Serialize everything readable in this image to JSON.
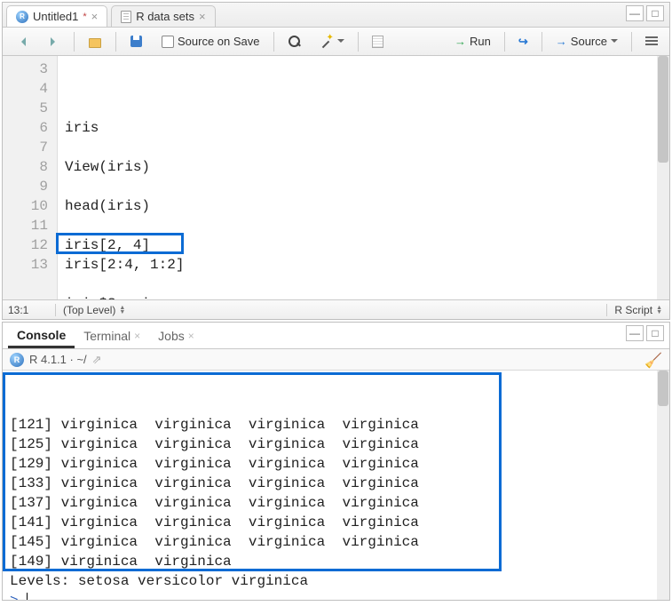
{
  "editor": {
    "tabs": [
      {
        "label": "Untitled1",
        "dirty": "*",
        "icon": "r"
      },
      {
        "label": "R data sets",
        "dirty": "",
        "icon": "doc"
      }
    ],
    "toolbar": {
      "source_on_save": "Source on Save",
      "run": "Run",
      "source": "Source"
    },
    "lines": [
      {
        "n": "3",
        "text": "iris"
      },
      {
        "n": "4",
        "text": ""
      },
      {
        "n": "5",
        "text": "View(iris)"
      },
      {
        "n": "6",
        "text": ""
      },
      {
        "n": "7",
        "text": "head(iris)"
      },
      {
        "n": "8",
        "text": ""
      },
      {
        "n": "9",
        "text": "iris[2, 4]"
      },
      {
        "n": "10",
        "text": "iris[2:4, 1:2]"
      },
      {
        "n": "11",
        "text": ""
      },
      {
        "n": "12",
        "text": "iris$Species"
      },
      {
        "n": "13",
        "text": ""
      }
    ],
    "status": {
      "position": "13:1",
      "scope": "(Top Level)",
      "language": "R Script"
    }
  },
  "console": {
    "tabs": {
      "console": "Console",
      "terminal": "Terminal",
      "jobs": "Jobs"
    },
    "info": "R 4.1.1 · ~/",
    "output_lines": [
      "[121] virginica  virginica  virginica  virginica ",
      "[125] virginica  virginica  virginica  virginica ",
      "[129] virginica  virginica  virginica  virginica ",
      "[133] virginica  virginica  virginica  virginica ",
      "[137] virginica  virginica  virginica  virginica ",
      "[141] virginica  virginica  virginica  virginica ",
      "[145] virginica  virginica  virginica  virginica ",
      "[149] virginica  virginica ",
      "Levels: setosa versicolor virginica"
    ],
    "prompt": ">"
  }
}
